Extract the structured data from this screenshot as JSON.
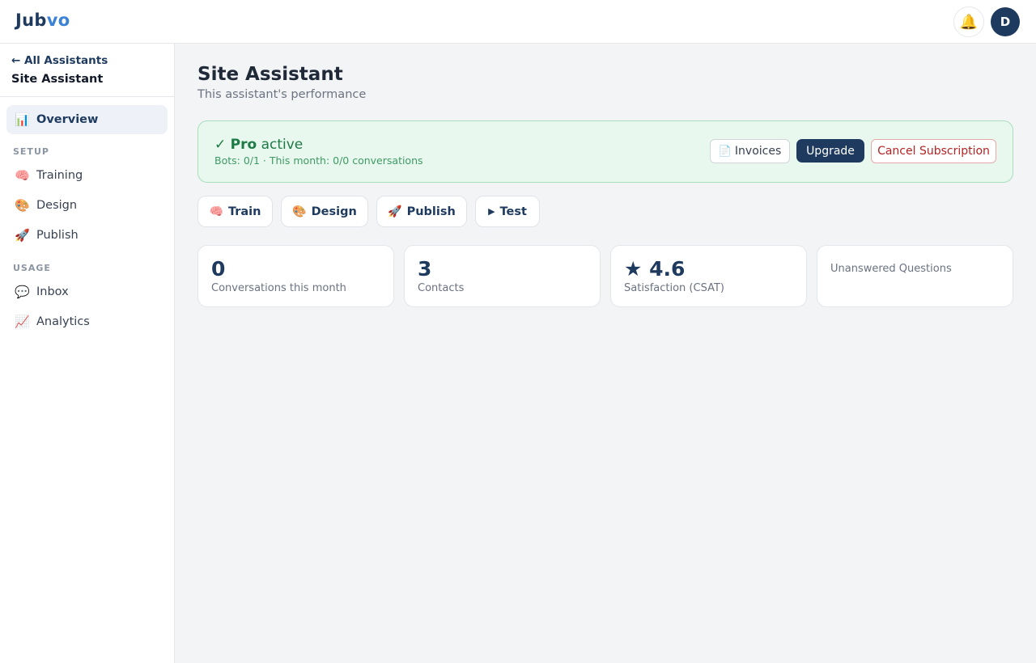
{
  "app": {
    "logo_part1": "Jub",
    "logo_part2": "vo",
    "avatar_initial": "D",
    "bell_icon": "🔔"
  },
  "sidebar": {
    "back_label": "← All Assistants",
    "title": "Site Assistant",
    "overview": {
      "icon": "📊",
      "label": "Overview"
    },
    "setup_label": "SETUP",
    "setup_items": [
      {
        "icon": "🧠",
        "label": "Training"
      },
      {
        "icon": "🎨",
        "label": "Design"
      },
      {
        "icon": "🚀",
        "label": "Publish"
      }
    ],
    "usage_label": "USAGE",
    "usage_items": [
      {
        "icon": "💬",
        "label": "Inbox"
      },
      {
        "icon": "📈",
        "label": "Analytics"
      }
    ]
  },
  "main": {
    "title": "Site Assistant",
    "subtitle": "This assistant's performance"
  },
  "subscription": {
    "check": "✓",
    "plan": "Pro",
    "status": "active",
    "usage": "Bots: 0/1 · This month: 0/0 conversations",
    "invoices_icon": "📄",
    "invoices_label": "Invoices",
    "upgrade_label": "Upgrade",
    "cancel_label": "Cancel Subscription"
  },
  "quick_actions": [
    {
      "icon": "🧠",
      "label": "Train"
    },
    {
      "icon": "🎨",
      "label": "Design"
    },
    {
      "icon": "🚀",
      "label": "Publish"
    },
    {
      "icon": "▶",
      "label": "Test"
    }
  ],
  "stats": [
    {
      "value": "0",
      "label": "Conversations this month"
    },
    {
      "value": "3",
      "label": "Contacts"
    },
    {
      "value": "★ 4.6",
      "label": "Satisfaction (CSAT)"
    },
    {
      "value": "",
      "label": "Unanswered Questions"
    }
  ]
}
